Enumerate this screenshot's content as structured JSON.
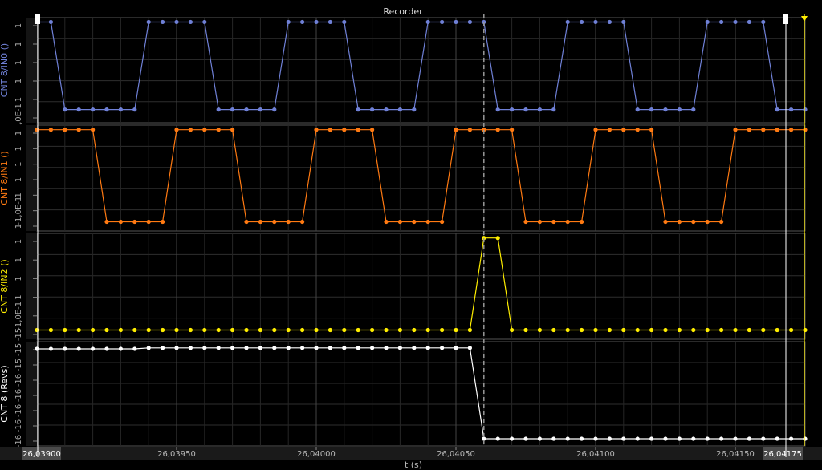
{
  "window": {
    "title": "Recorder"
  },
  "chart_data": {
    "type": "line",
    "title": "Recorder",
    "xlabel": "t (s)",
    "grid": true,
    "x_tick_labels": [
      "26,03950",
      "26,04000",
      "26,04050",
      "26,04100",
      "26,04150"
    ],
    "x_range_start_label": "26,03900",
    "x_range_end_label": "26,04175",
    "x_range": [
      26.039,
      26.04175
    ],
    "cursor_x": 26.0406,
    "channels": [
      {
        "name": "CNT 8/IN0 ()",
        "color": "#6f80d6",
        "tick_labels": [
          "1",
          "1",
          "1",
          "1",
          "1",
          "-1,0E-1"
        ],
        "ylim": [
          -0.15,
          1.05
        ],
        "x": [
          26.039,
          26.03905,
          26.0391,
          26.03915,
          26.0392,
          26.03925,
          26.0393,
          26.03935,
          26.0394,
          26.03945,
          26.0395,
          26.03955,
          26.0396,
          26.03965,
          26.0397,
          26.03975,
          26.0398,
          26.03985,
          26.0399,
          26.03995,
          26.04,
          26.04005,
          26.0401,
          26.04015,
          26.0402,
          26.04025,
          26.0403,
          26.04035,
          26.0404,
          26.04045,
          26.0405,
          26.04055,
          26.0406,
          26.04065,
          26.0407,
          26.04075,
          26.0408,
          26.04085,
          26.0409,
          26.04095,
          26.041,
          26.04105,
          26.0411,
          26.04115,
          26.0412,
          26.04125,
          26.0413,
          26.04135,
          26.0414,
          26.04145,
          26.0415,
          26.04155,
          26.0416,
          26.04165,
          26.0417,
          26.04175
        ],
        "y": [
          1,
          1,
          0,
          0,
          0,
          0,
          0,
          0,
          1,
          1,
          1,
          1,
          1,
          0,
          0,
          0,
          0,
          0,
          1,
          1,
          1,
          1,
          1,
          0,
          0,
          0,
          0,
          0,
          1,
          1,
          1,
          1,
          1,
          0,
          0,
          0,
          0,
          0,
          1,
          1,
          1,
          1,
          1,
          0,
          0,
          0,
          0,
          0,
          1,
          1,
          1,
          1,
          1,
          0,
          0,
          0
        ]
      },
      {
        "name": "CNT 8/IN1 ()",
        "color": "#ff7a12",
        "tick_labels": [
          "1",
          "1",
          "1",
          "1",
          "1",
          "-1,0E-1",
          "1"
        ],
        "ylim": [
          -0.1,
          1.05
        ],
        "x": [
          26.039,
          26.03905,
          26.0391,
          26.03915,
          26.0392,
          26.03925,
          26.0393,
          26.03935,
          26.0394,
          26.03945,
          26.0395,
          26.03955,
          26.0396,
          26.03965,
          26.0397,
          26.03975,
          26.0398,
          26.03985,
          26.0399,
          26.03995,
          26.04,
          26.04005,
          26.0401,
          26.04015,
          26.0402,
          26.04025,
          26.0403,
          26.04035,
          26.0404,
          26.04045,
          26.0405,
          26.04055,
          26.0406,
          26.04065,
          26.0407,
          26.04075,
          26.0408,
          26.04085,
          26.0409,
          26.04095,
          26.041,
          26.04105,
          26.0411,
          26.04115,
          26.0412,
          26.04125,
          26.0413,
          26.04135,
          26.0414,
          26.04145,
          26.0415,
          26.04155,
          26.0416,
          26.04165,
          26.0417,
          26.04175
        ],
        "y": [
          1,
          1,
          1,
          1,
          1,
          0,
          0,
          0,
          0,
          0,
          1,
          1,
          1,
          1,
          1,
          0,
          0,
          0,
          0,
          0,
          1,
          1,
          1,
          1,
          1,
          0,
          0,
          0,
          0,
          0,
          1,
          1,
          1,
          1,
          1,
          0,
          0,
          0,
          0,
          0,
          1,
          1,
          1,
          1,
          1,
          0,
          0,
          0,
          0,
          0,
          1,
          1,
          1,
          1,
          1,
          1
        ]
      },
      {
        "name": "CNT 8/IN2 ()",
        "color": "#ffee00",
        "tick_labels": [
          "1",
          "1",
          "1",
          "1",
          "-1,0E-1",
          "-15"
        ],
        "ylim": [
          -0.1,
          1.05
        ],
        "x": [
          26.039,
          26.03905,
          26.0391,
          26.03915,
          26.0392,
          26.03925,
          26.0393,
          26.03935,
          26.0394,
          26.03945,
          26.0395,
          26.03955,
          26.0396,
          26.03965,
          26.0397,
          26.03975,
          26.0398,
          26.03985,
          26.0399,
          26.03995,
          26.04,
          26.04005,
          26.0401,
          26.04015,
          26.0402,
          26.04025,
          26.0403,
          26.04035,
          26.0404,
          26.04045,
          26.0405,
          26.04055,
          26.0406,
          26.04065,
          26.0407,
          26.04075,
          26.0408,
          26.04085,
          26.0409,
          26.04095,
          26.041,
          26.04105,
          26.0411,
          26.04115,
          26.0412,
          26.04125,
          26.0413,
          26.04135,
          26.0414,
          26.04145,
          26.0415,
          26.04155,
          26.0416,
          26.04165,
          26.0417,
          26.04175
        ],
        "y": [
          0,
          0,
          0,
          0,
          0,
          0,
          0,
          0,
          0,
          0,
          0,
          0,
          0,
          0,
          0,
          0,
          0,
          0,
          0,
          0,
          0,
          0,
          0,
          0,
          0,
          0,
          0,
          0,
          0,
          0,
          0,
          0,
          1,
          1,
          0,
          0,
          0,
          0,
          0,
          0,
          0,
          0,
          0,
          0,
          0,
          0,
          0,
          0,
          0,
          0,
          0,
          0,
          0,
          0,
          0,
          0
        ]
      },
      {
        "name": "CNT 8 (Revs)",
        "color": "#ffffff",
        "tick_labels": [
          "-15",
          "-15",
          "-16",
          "-16",
          "-16",
          "-16",
          "-16"
        ],
        "ylim": [
          -16.08,
          -14.92
        ],
        "x": [
          26.039,
          26.03905,
          26.0391,
          26.03915,
          26.0392,
          26.03925,
          26.0393,
          26.03935,
          26.0394,
          26.03945,
          26.0395,
          26.03955,
          26.0396,
          26.03965,
          26.0397,
          26.03975,
          26.0398,
          26.03985,
          26.0399,
          26.03995,
          26.04,
          26.04005,
          26.0401,
          26.04015,
          26.0402,
          26.04025,
          26.0403,
          26.04035,
          26.0404,
          26.04045,
          26.0405,
          26.04055,
          26.0406,
          26.04065,
          26.0407,
          26.04075,
          26.0408,
          26.04085,
          26.0409,
          26.04095,
          26.041,
          26.04105,
          26.0411,
          26.04115,
          26.0412,
          26.04125,
          26.0413,
          26.04135,
          26.0414,
          26.04145,
          26.0415,
          26.04155,
          26.0416,
          26.04165,
          26.0417,
          26.04175
        ],
        "y": [
          -15.0,
          -15.0,
          -15.0,
          -15.0,
          -15.0,
          -15.0,
          -15.0,
          -15.0,
          -14.99,
          -14.99,
          -14.99,
          -14.99,
          -14.99,
          -14.99,
          -14.99,
          -14.99,
          -14.99,
          -14.99,
          -14.99,
          -14.99,
          -14.99,
          -14.99,
          -14.99,
          -14.99,
          -14.99,
          -14.99,
          -14.99,
          -14.99,
          -14.99,
          -14.99,
          -14.99,
          -14.99,
          -16.0,
          -16.0,
          -16.0,
          -16.0,
          -16.0,
          -16.0,
          -16.0,
          -16.0,
          -16.0,
          -16.0,
          -16.0,
          -16.0,
          -16.0,
          -16.0,
          -16.0,
          -16.0,
          -16.0,
          -16.0,
          -16.0,
          -16.0,
          -16.0,
          -16.0,
          -16.0,
          -16.0
        ]
      }
    ]
  }
}
